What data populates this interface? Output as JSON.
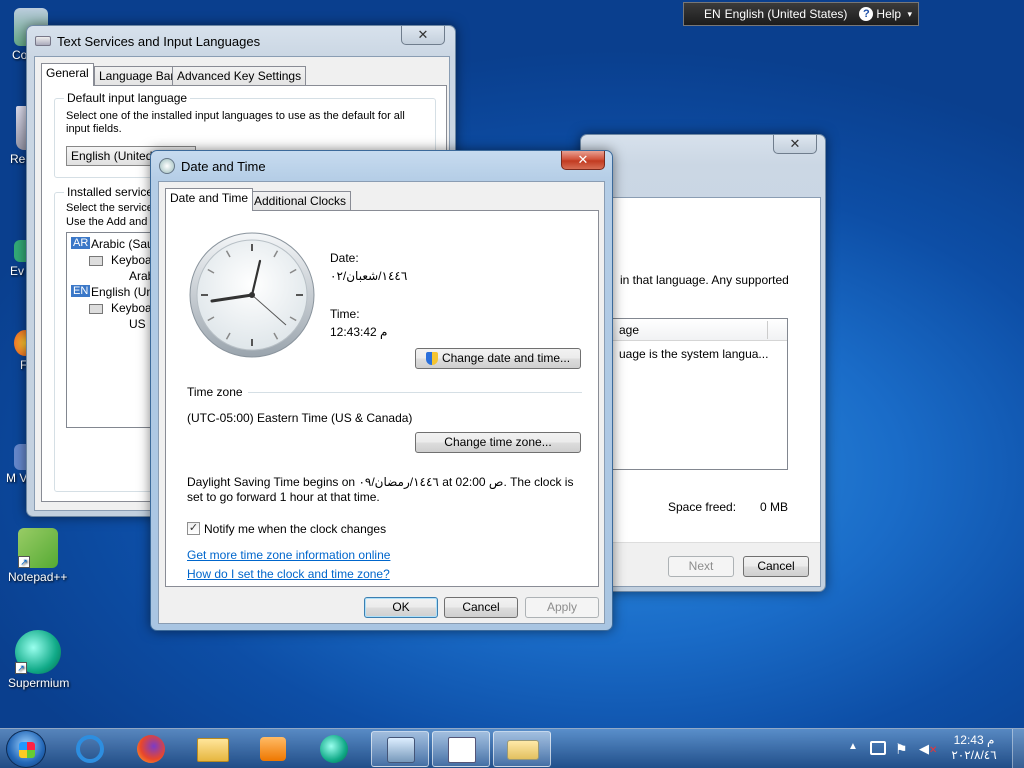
{
  "desktop": {
    "icons": [
      {
        "label": "Co"
      },
      {
        "label": "Rec"
      },
      {
        "label": "Ev"
      },
      {
        "label": "F"
      },
      {
        "label": "M Visu"
      },
      {
        "label": "Notepad++"
      },
      {
        "label": "Supermium"
      }
    ]
  },
  "langbar": {
    "lang_code": "EN",
    "lang_name": "English (United States)",
    "help": "Help"
  },
  "text_services": {
    "title": "Text Services and Input Languages",
    "tabs": [
      "General",
      "Language Bar",
      "Advanced Key Settings"
    ],
    "default_group": "Default input language",
    "default_desc": "Select one of the installed input languages to use as the default for all input fields.",
    "default_value": "English (United St",
    "installed_group": "Installed services",
    "installed_desc1": "Select the service",
    "installed_desc2": "Use the Add and R",
    "tree": {
      "ar_badge": "AR",
      "ar_label": "Arabic (Saud",
      "ar_keyboard": "Keyboard",
      "ar_item": "Arab",
      "en_badge": "EN",
      "en_label": "English (Unite",
      "en_keyboard": "Keyboard",
      "en_item": "US"
    }
  },
  "wizard": {
    "text_partial": "in that language. Any supported",
    "col_header": "age",
    "row_text": "uage is the system langua...",
    "space_freed_label": "Space freed:",
    "space_freed_value": "0 MB",
    "next": "Next",
    "cancel": "Cancel"
  },
  "datetime": {
    "title": "Date and Time",
    "tabs": [
      "Date and Time",
      "Additional Clocks"
    ],
    "date_label": "Date:",
    "date_value": "١٤٤٦/شعبان/٠٢",
    "time_label": "Time:",
    "time_value": "12:43:42 م",
    "change_dt": "Change date and time...",
    "tz_header": "Time zone",
    "tz_value": "(UTC-05:00) Eastern Time (US & Canada)",
    "change_tz": "Change time zone...",
    "dst_text": "Daylight Saving Time begins on ١٤٤٦/رمضان/٠٩ at 02:00 ص. The clock is set to go forward 1 hour at that time.",
    "notify": "Notify me when the clock changes",
    "notify_checked": true,
    "link1": "Get more time zone information online",
    "link2": "How do I set the clock and time zone?",
    "ok": "OK",
    "cancel": "Cancel",
    "apply": "Apply"
  },
  "taskbar": {
    "clock_time": "12:43 م",
    "clock_date": "٢٠٢/٨/٤٦"
  },
  "colors": {
    "link": "#0066cc",
    "accent": "#3c7fb1",
    "close_red": "#c23b21"
  }
}
